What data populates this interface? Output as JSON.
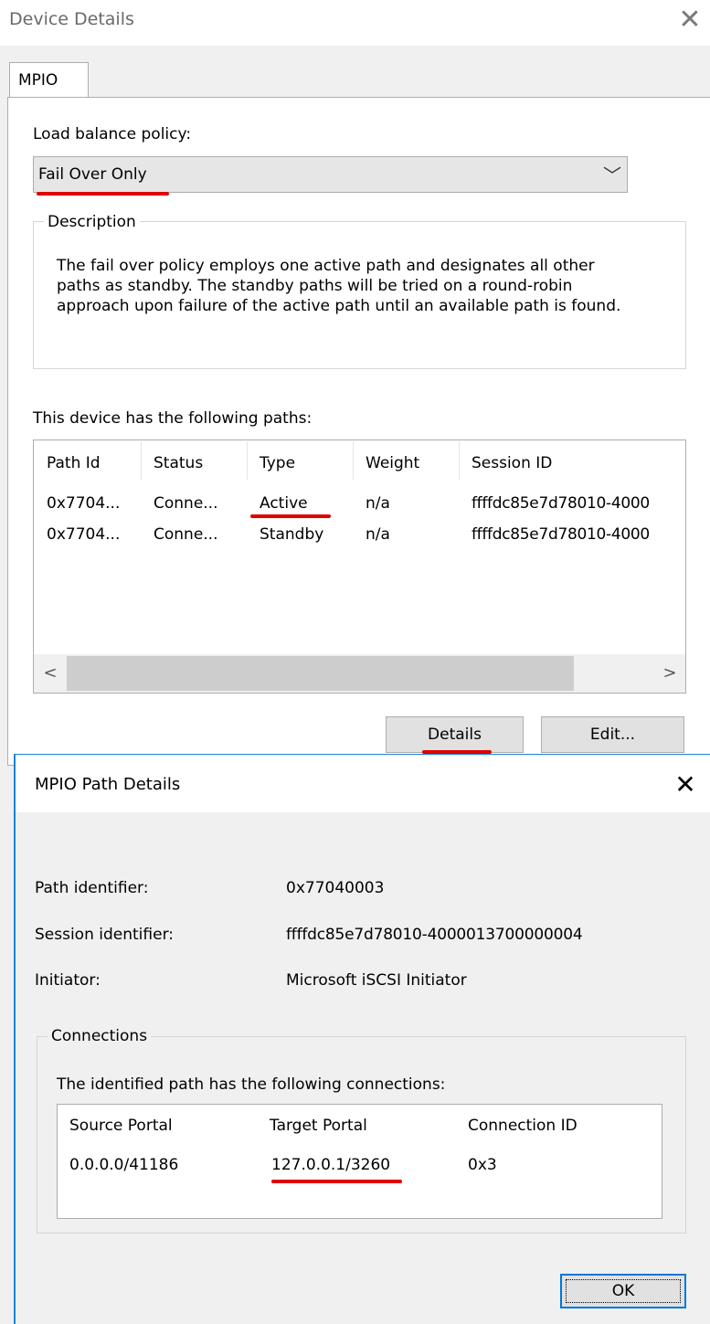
{
  "device_details": {
    "title": "Device Details",
    "close_glyph": "✕",
    "tab": "MPIO",
    "load_balance_label": "Load balance policy:",
    "load_balance_value": "Fail Over Only",
    "chevron": "﹀",
    "description_legend": "Description",
    "description_text": "The fail over policy employs one active path and designates all other paths as standby.  The standby paths will be tried on a round-robin approach upon failure of the active path until an available path is found.",
    "paths_label": "This device has the following paths:",
    "paths_columns": [
      "Path Id",
      "Status",
      "Type",
      "Weight",
      "Session ID"
    ],
    "paths_rows": [
      [
        "0x7704...",
        "Conne...",
        "Active",
        "n/a",
        "ffffdc85e7d78010-4000"
      ],
      [
        "0x7704...",
        "Conne...",
        "Standby",
        "n/a",
        "ffffdc85e7d78010-4000"
      ]
    ],
    "scroll_left": "<",
    "scroll_right": ">",
    "details_button": "Details",
    "edit_button": "Edit..."
  },
  "path_details": {
    "title": "MPIO Path Details",
    "close_glyph": "✕",
    "fields": [
      {
        "label": "Path identifier:",
        "value": "0x77040003"
      },
      {
        "label": "Session identifier:",
        "value": "ffffdc85e7d78010-4000013700000004"
      },
      {
        "label": "Initiator:",
        "value": "Microsoft iSCSI Initiator"
      }
    ],
    "connections_legend": "Connections",
    "connections_label": "The identified path has the following connections:",
    "connections_columns": [
      "Source Portal",
      "Target Portal",
      "Connection ID"
    ],
    "connections_rows": [
      [
        "0.0.0.0/41186",
        "127.0.0.1/3260",
        "0x3"
      ]
    ],
    "ok_button": "OK"
  },
  "colors": {
    "highlight_underline": "#e00000",
    "dialog_accent": "#1883d7"
  }
}
